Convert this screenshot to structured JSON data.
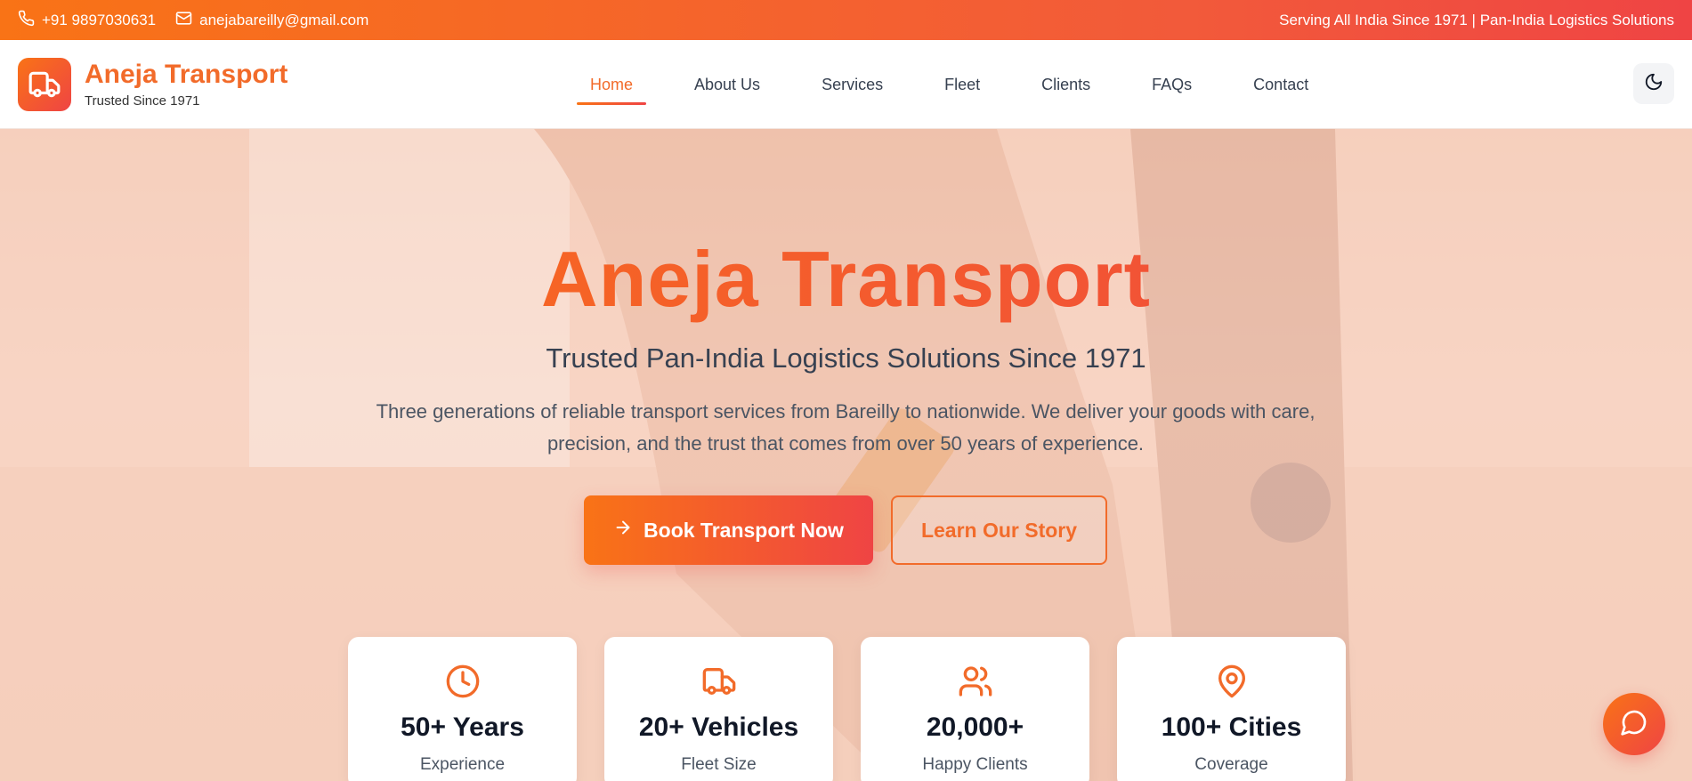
{
  "topbar": {
    "phone": "+91 9897030631",
    "email": "anejabareilly@gmail.com",
    "tagline": "Serving All India Since 1971 | Pan-India Logistics Solutions"
  },
  "brand": {
    "name": "Aneja Transport",
    "subtitle": "Trusted Since 1971"
  },
  "nav": {
    "items": [
      {
        "label": "Home",
        "active": true
      },
      {
        "label": "About Us"
      },
      {
        "label": "Services"
      },
      {
        "label": "Fleet"
      },
      {
        "label": "Clients"
      },
      {
        "label": "FAQs"
      },
      {
        "label": "Contact"
      }
    ]
  },
  "hero": {
    "title": "Aneja Transport",
    "subtitle": "Trusted Pan-India Logistics Solutions Since 1971",
    "description": "Three generations of reliable transport services from Bareilly to nationwide. We deliver your goods with care, precision, and the trust that comes from over 50 years of experience.",
    "primary_button": "Book Transport Now",
    "secondary_button": "Learn Our Story"
  },
  "stats": [
    {
      "icon": "clock-icon",
      "value": "50+ Years",
      "label": "Experience"
    },
    {
      "icon": "truck-icon",
      "value": "20+ Vehicles",
      "label": "Fleet Size"
    },
    {
      "icon": "users-icon",
      "value": "20,000+",
      "label": "Happy Clients"
    },
    {
      "icon": "map-pin-icon",
      "value": "100+ Cities",
      "label": "Coverage"
    }
  ],
  "colors": {
    "accent_start": "#f97316",
    "accent_end": "#ef4444"
  }
}
